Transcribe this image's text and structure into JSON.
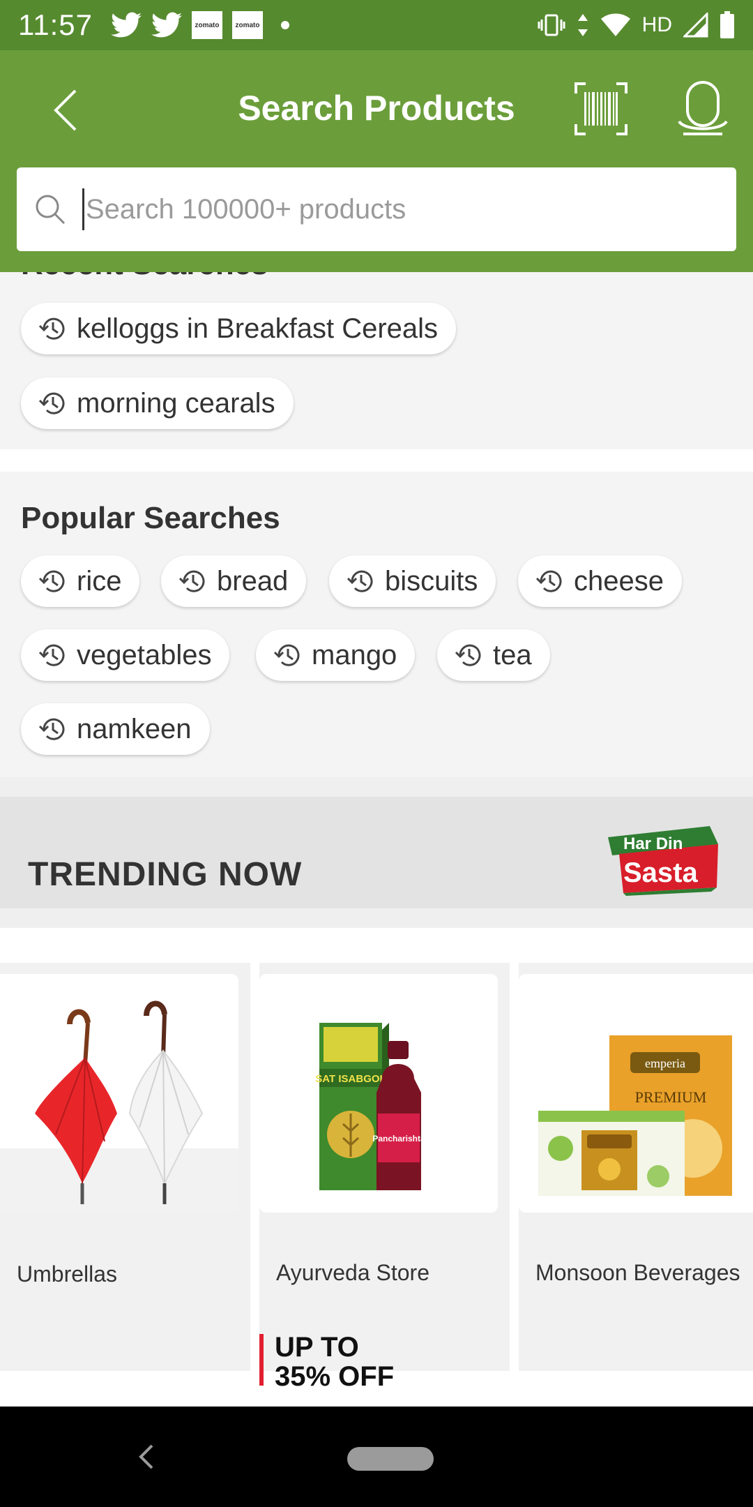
{
  "status_bar": {
    "time": "11:57",
    "zomato_label": "zomato",
    "network_label": "HD"
  },
  "app_bar": {
    "title": "Search Products"
  },
  "search": {
    "placeholder": "Search 100000+ products"
  },
  "recent": {
    "heading": "Recent Searches",
    "items": [
      "kelloggs in Breakfast Cereals",
      "morning cearals"
    ]
  },
  "popular": {
    "heading": "Popular Searches",
    "items": [
      "rice",
      "bread",
      "biscuits",
      "cheese",
      "vegetables",
      "mango",
      "tea",
      "namkeen"
    ]
  },
  "trending": {
    "title": "TRENDING NOW",
    "badge_line1": "Har Din",
    "badge_line2": "Sasta",
    "products": [
      {
        "name": "Umbrellas",
        "image": "umbrella-image"
      },
      {
        "name": "Ayurveda Store",
        "image": "ayurveda-products-image",
        "offer": "UP TO 35% OFF",
        "image_text": "SAT ISABGOL",
        "image_text2": "Pancharishta"
      },
      {
        "name": "Monsoon Beverages",
        "image": "tea-boxes-image",
        "image_text": "emperia",
        "image_text2": "PREMIUM"
      }
    ]
  },
  "colors": {
    "brand_green": "#6b9e3a",
    "status_green": "#568a2f",
    "offer_red": "#e02030"
  }
}
